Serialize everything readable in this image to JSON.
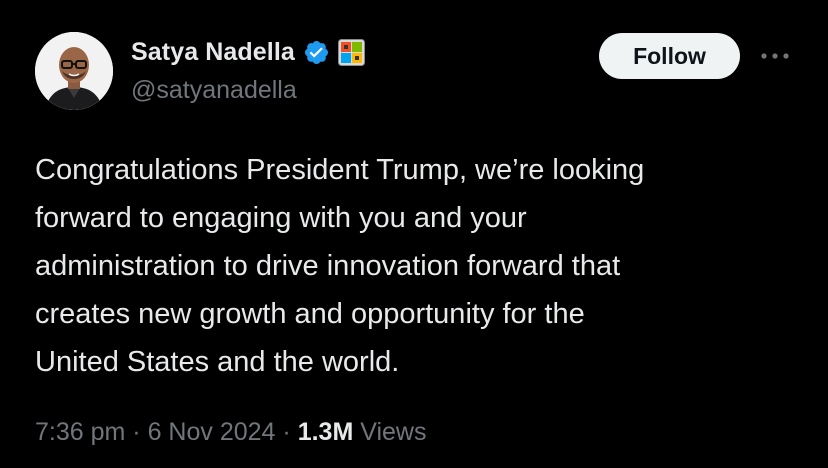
{
  "author": {
    "display_name": "Satya Nadella",
    "handle": "@satyanadella",
    "verified_icon": "verified-badge-icon",
    "affiliation_icon": "microsoft-affiliate-badge-icon",
    "avatar": "profile-photo"
  },
  "actions": {
    "follow_label": "Follow",
    "more_icon": "more-options-icon"
  },
  "tweet": {
    "text_lines": [
      "Congratulations President Trump, we’re looking",
      "forward to engaging with you and your",
      "administration to drive innovation forward that",
      "creates new growth and opportunity for the",
      "United States and the world."
    ]
  },
  "meta": {
    "time": "7:36 pm",
    "separator": "·",
    "date": "6 Nov 2024",
    "views_count": "1.3M",
    "views_label": "Views"
  },
  "colors": {
    "background": "#000000",
    "primary_text": "#e7e9ea",
    "secondary_text": "#71767b",
    "verified_blue": "#1d9bf0",
    "follow_bg": "#eff3f4"
  }
}
